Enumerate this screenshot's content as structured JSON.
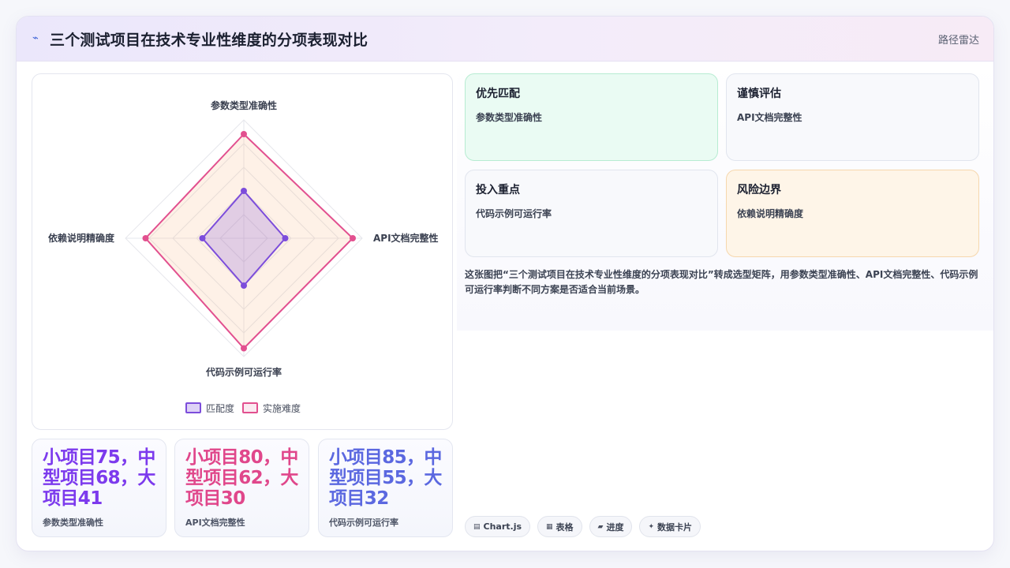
{
  "header": {
    "icon": "wave-icon",
    "title": "三个测试项目在技术专业性维度的分项表现对比",
    "tag": "路径雷达"
  },
  "chart_data": {
    "type": "radar",
    "axes": [
      "参数类型准确性",
      "API文档完整性",
      "代码示例可运行率",
      "依赖说明精确度"
    ],
    "rlim": [
      0,
      100
    ],
    "grid": true,
    "legend_position": "bottom",
    "series": [
      {
        "name": "匹配度",
        "values": [
          40,
          35,
          40,
          35
        ],
        "color": "#7c4ddb"
      },
      {
        "name": "实施难度",
        "values": [
          88,
          92,
          93,
          83
        ],
        "color": "#e2508f"
      }
    ]
  },
  "stats": [
    {
      "value": "小项目75，中型项目68，大项目41",
      "label": "参数类型准确性",
      "color": "#7c3aed"
    },
    {
      "value": "小项目80，中型项目62，大项目30",
      "label": "API文档完整性",
      "color": "#e0478b"
    },
    {
      "value": "小项目85，中型项目55，大项目32",
      "label": "代码示例可运行率",
      "color": "#5b68e0"
    }
  ],
  "insights": [
    {
      "title": "优先匹配",
      "text": "参数类型准确性"
    },
    {
      "title": "谨慎评估",
      "text": "API文档完整性"
    },
    {
      "title": "投入重点",
      "text": "代码示例可运行率"
    },
    {
      "title": "风险边界",
      "text": "依赖说明精确度"
    }
  ],
  "description": "这张图把“三个测试项目在技术专业性维度的分项表现对比”转成选型矩阵，用参数类型准确性、API文档完整性、代码示例可运行率判断不同方案是否适合当前场景。",
  "chips": [
    {
      "icon": "chart-icon",
      "glyph": "▤",
      "label": "Chart.js"
    },
    {
      "icon": "table-icon",
      "glyph": "▦",
      "label": "表格"
    },
    {
      "icon": "progress-icon",
      "glyph": "▰",
      "label": "进度"
    },
    {
      "icon": "card-icon",
      "glyph": "✦",
      "label": "数据卡片"
    }
  ]
}
